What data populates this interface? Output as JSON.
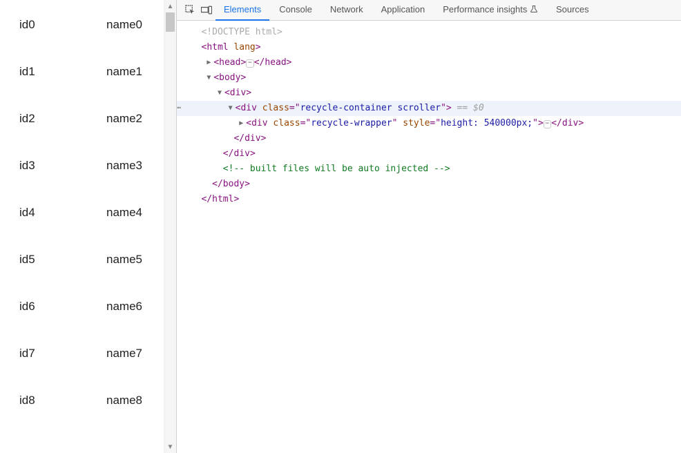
{
  "list": {
    "rows": [
      {
        "id": "id0",
        "name": "name0"
      },
      {
        "id": "id1",
        "name": "name1"
      },
      {
        "id": "id2",
        "name": "name2"
      },
      {
        "id": "id3",
        "name": "name3"
      },
      {
        "id": "id4",
        "name": "name4"
      },
      {
        "id": "id5",
        "name": "name5"
      },
      {
        "id": "id6",
        "name": "name6"
      },
      {
        "id": "id7",
        "name": "name7"
      },
      {
        "id": "id8",
        "name": "name8"
      }
    ]
  },
  "devtools": {
    "tabs": {
      "elements": "Elements",
      "console": "Console",
      "network": "Network",
      "application": "Application",
      "perf": "Performance insights",
      "sources": "Sources"
    },
    "dom": {
      "doctype": "<!DOCTYPE html>",
      "html_open": "html",
      "html_lang_attr": "lang",
      "head": "head",
      "body": "body",
      "div": "div",
      "class_attr": "class",
      "style_attr": "style",
      "container_class": "recycle-container scroller",
      "wrapper_class": "recycle-wrapper",
      "wrapper_style": "height: 540000px;",
      "selected_marker": " == ",
      "selected_var": "$0",
      "comment": " built files will be auto injected "
    }
  }
}
